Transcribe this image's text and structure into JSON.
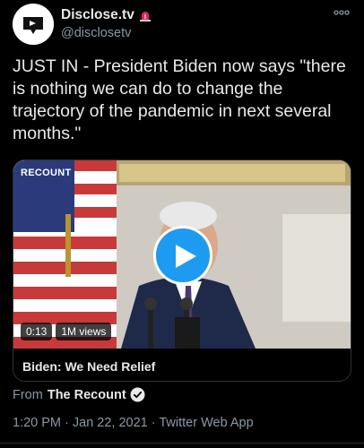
{
  "author": {
    "display_name": "Disclose.tv",
    "handle": "@disclosetv",
    "badge_icon": "rotating-light-icon",
    "avatar_icon": "disclose-tv-logo-icon"
  },
  "more_icon": "more-options-icon",
  "tweet": {
    "text": "JUST IN - President Biden now says \"there is nothing we can do to change the trajectory of the pandemic in next several months.\""
  },
  "media": {
    "watermark": "RECOUNT",
    "duration": "0:13",
    "views": "1M views",
    "title": "Biden: We Need Relief",
    "play_icon": "play-icon"
  },
  "source": {
    "prefix": "From",
    "name": "The Recount",
    "verified_icon": "verified-check-icon"
  },
  "meta": {
    "timestamp": "1:20 PM · Jan 22, 2021 · Twitter Web App"
  },
  "colors": {
    "background": "#000000",
    "text": "#e7e9ea",
    "secondary_text": "#8b98a5",
    "accent": "#1d9bf0",
    "border": "#2f3336"
  }
}
